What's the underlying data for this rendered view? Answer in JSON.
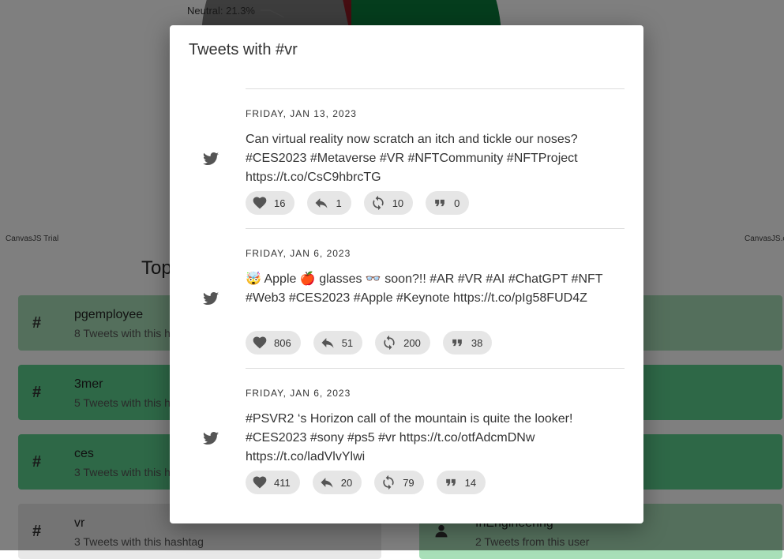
{
  "background": {
    "neutral_label": "Neutral: 21.3%",
    "trial_left": "CanvasJS Trial",
    "trial_right": "CanvasJS.co",
    "top_heading": "Top",
    "left_cards": [
      {
        "title": "pgemployee",
        "subtitle": "8 Tweets with this h"
      },
      {
        "title": "3mer",
        "subtitle": "5 Tweets with this h"
      },
      {
        "title": "ces",
        "subtitle": "3 Tweets with this h"
      },
      {
        "title": "vr",
        "subtitle": "3 Tweets with this hashtag"
      }
    ],
    "right_card": {
      "title": "fnEngineering",
      "subtitle": "2 Tweets from this user"
    },
    "colors": {
      "pie_green": "#0b7a3b",
      "pie_red": "#8b1a22",
      "pie_grey": "#7a7a7a"
    }
  },
  "modal": {
    "title": "Tweets with #vr",
    "tweets": [
      {
        "date": "FRIDAY, JAN 13, 2023",
        "text": "Can virtual reality now scratch an itch and tickle our noses? #CES2023 #Metaverse #VR #NFTCommunity #NFTProject https://t.co/CsC9hbrcTG",
        "likes": "16",
        "replies": "1",
        "retweets": "10",
        "quotes": "0"
      },
      {
        "date": "FRIDAY, JAN 6, 2023",
        "text": "🤯 Apple 🍎 glasses 👓 soon?!! #AR #VR #AI #ChatGPT #NFT #Web3 #CES2023 #Apple #Keynote https://t.co/pIg58FUD4Z",
        "likes": "806",
        "replies": "51",
        "retweets": "200",
        "quotes": "38"
      },
      {
        "date": "FRIDAY, JAN 6, 2023",
        "text": "#PSVR2 ‘s Horizon call of the mountain is quite the looker! #CES2023 #sony #ps5 #vr https://t.co/otfAdcmDNw https://t.co/ladVlvYlwi",
        "likes": "411",
        "replies": "20",
        "retweets": "79",
        "quotes": "14"
      }
    ]
  }
}
